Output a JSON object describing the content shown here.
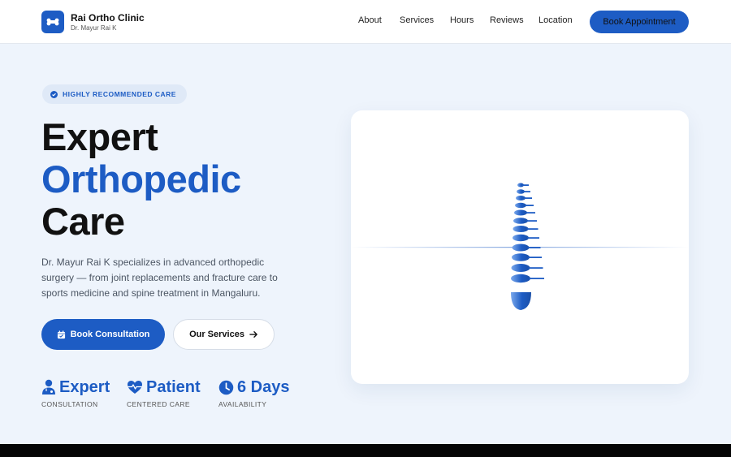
{
  "header": {
    "brand_name": "Rai Ortho Clinic",
    "brand_sub": "Dr. Mayur Rai K",
    "logo_icon": "bone-icon",
    "nav": [
      "About",
      "Services",
      "Hours",
      "Reviews",
      "Location"
    ],
    "cta": "Book Appointment"
  },
  "hero": {
    "badge": "HIGHLY RECOMMENDED CARE",
    "badge_icon": "check-circle-icon",
    "title_line1": "Expert",
    "title_line2": "Orthopedic",
    "title_line3": "Care",
    "description": "Dr. Mayur Rai K specializes in advanced orthopedic surgery — from joint replacements and fracture care to sports medicine and spine treatment in Mangaluru.",
    "primary_button": "Book Consultation",
    "primary_icon": "calendar-check-icon",
    "secondary_button": "Our Services",
    "secondary_icon": "arrow-right-icon"
  },
  "stats": [
    {
      "title": "Expert",
      "sub": "CONSULTATION",
      "icon": "doctor-icon"
    },
    {
      "title": "Patient",
      "sub": "CENTERED CARE",
      "icon": "heart-pulse-icon"
    },
    {
      "title": "6 Days",
      "sub": "AVAILABILITY",
      "icon": "clock-icon"
    }
  ],
  "image": {
    "illustration": "spine-illustration"
  },
  "colors": {
    "accent": "#1d5cc4",
    "background": "#eef4fc",
    "footer": "#050505"
  }
}
